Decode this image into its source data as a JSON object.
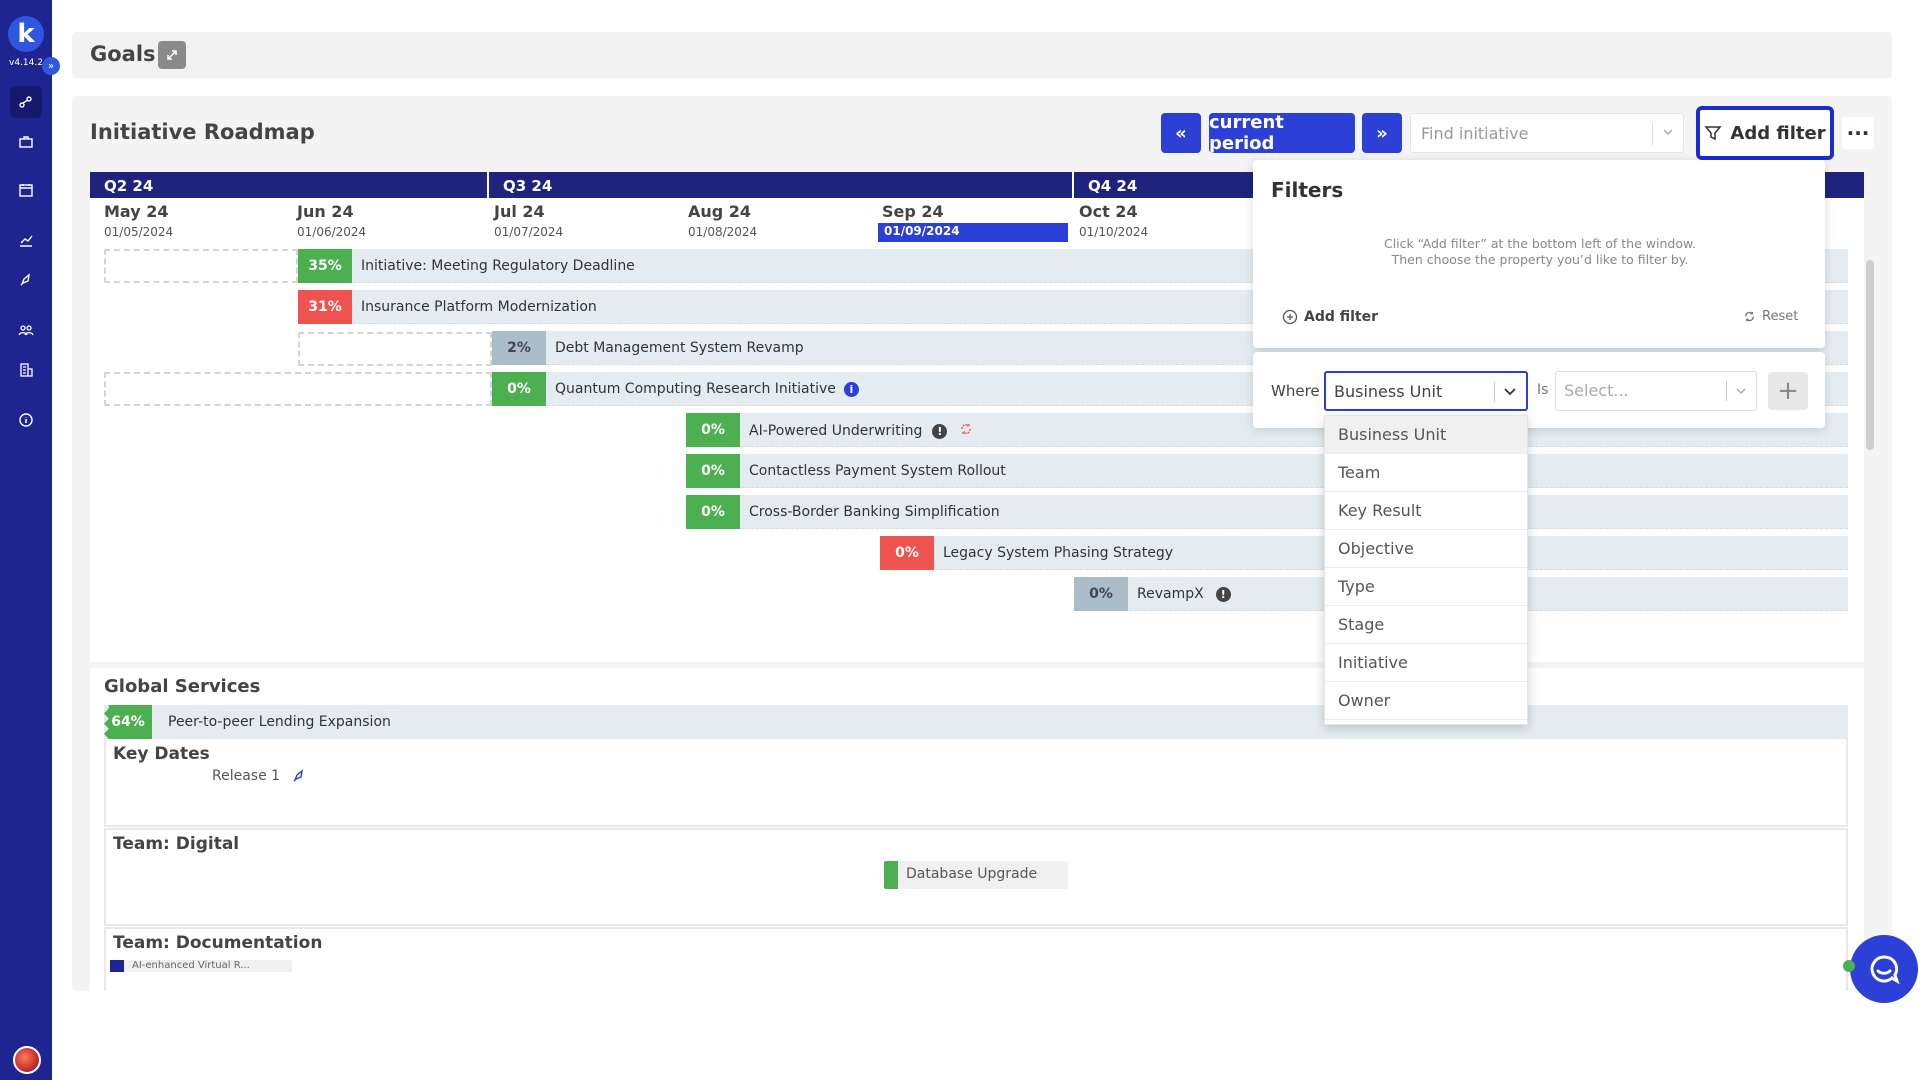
{
  "app": {
    "logo_letter": "k",
    "version": "v4.14.2"
  },
  "header": {
    "title": "Goals"
  },
  "roadmap": {
    "title": "Initiative Roadmap",
    "current_period": "current period",
    "find_placeholder": "Find initiative",
    "add_filter": "Add filter",
    "more": "···"
  },
  "timeline": {
    "quarters": [
      "Q2 24",
      "Q3 24",
      "Q4 24"
    ],
    "months": [
      {
        "name": "May 24",
        "date": "01/05/2024"
      },
      {
        "name": "Jun 24",
        "date": "01/06/2024"
      },
      {
        "name": "Jul 24",
        "date": "01/07/2024"
      },
      {
        "name": "Aug 24",
        "date": "01/08/2024"
      },
      {
        "name": "Sep 24",
        "date": "01/09/2024"
      },
      {
        "name": "Oct 24",
        "date": "01/10/2024"
      }
    ]
  },
  "rows": [
    {
      "pct": "35%",
      "name": "Initiative: Meeting Regulatory Deadline",
      "status": "green"
    },
    {
      "pct": "31%",
      "name": "Insurance Platform Modernization",
      "status": "red"
    },
    {
      "pct": "2%",
      "name": "Debt Management System Revamp",
      "status": "grey"
    },
    {
      "pct": "0%",
      "name": "Quantum Computing Research Initiative",
      "status": "green",
      "icon": "info-icon",
      "icon_color": "#2c3fd6"
    },
    {
      "pct": "0%",
      "name": "AI-Powered Underwriting",
      "status": "green",
      "icon": "alert-icon",
      "icon_color": "#444"
    },
    {
      "pct": "0%",
      "name": "Contactless Payment System Rollout",
      "status": "green"
    },
    {
      "pct": "0%",
      "name": "Cross-Border Banking Simplification",
      "status": "green"
    },
    {
      "pct": "0%",
      "name": "Legacy System Phasing Strategy",
      "status": "red"
    },
    {
      "pct": "0%",
      "name": "RevampX",
      "status": "grey",
      "icon": "alert-icon",
      "icon_color": "#444"
    }
  ],
  "global": {
    "title": "Global Services",
    "row": {
      "pct": "64%",
      "name": "Peer-to-peer Lending Expansion"
    },
    "key_dates": "Key Dates",
    "release": "Release 1",
    "team_digital": "Team: Digital",
    "database_upgrade": "Database Upgrade",
    "team_docs": "Team: Documentation",
    "ai_item": "AI-enhanced Virtual R..."
  },
  "filters": {
    "title": "Filters",
    "hint_line1": "Click “Add filter” at the bottom left of the window.",
    "hint_line2": "Then choose the property you’d like to filter by.",
    "add_filter": "Add filter",
    "reset": "Reset",
    "where": "Where",
    "selected": "Business Unit",
    "is": "Is",
    "value_placeholder": "Select...",
    "options": [
      "Business Unit",
      "Team",
      "Key Result",
      "Objective",
      "Type",
      "Stage",
      "Initiative",
      "Owner"
    ]
  },
  "colors": {
    "brand": "#1f2590",
    "accent": "#2c3fd6",
    "green": "#4caf50",
    "red": "#ef5350",
    "grey": "#a9bec8"
  }
}
